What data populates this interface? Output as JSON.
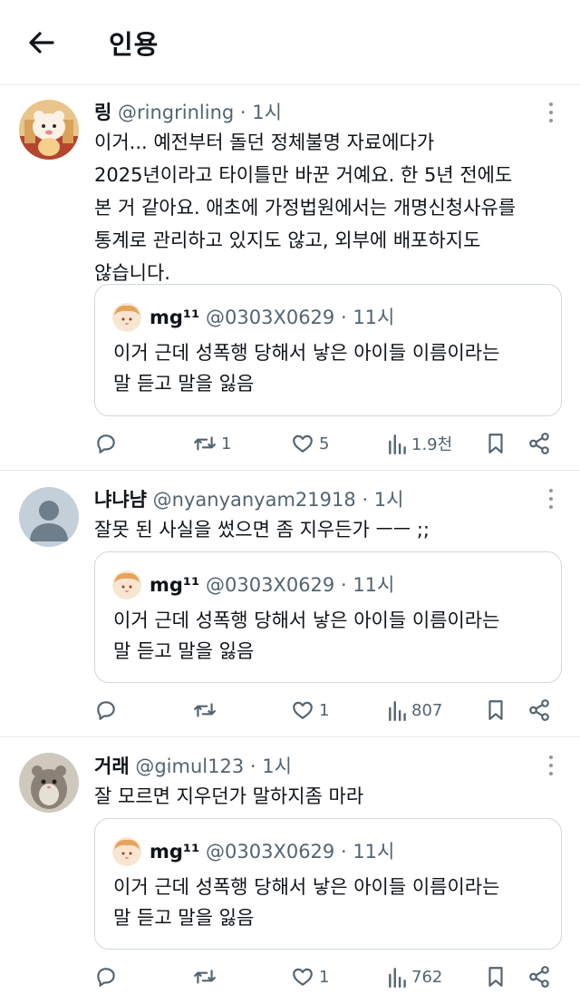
{
  "header": {
    "title": "인용"
  },
  "posts": [
    {
      "name": "링",
      "handle": "@ringrinling",
      "time": "· 1시",
      "text": "이거... 예전부터 돌던 정체불명 자료에다가\n2025년이라고 타이틀만 바꾼 거예요. 한 5년 전에도\n본 거 같아요. 애초에 가정법원에서는 개명신청사유를\n통계로 관리하고 있지도 않고, 외부에 배포하지도\n않습니다.",
      "quote": {
        "name": "mg¹¹",
        "handle": "@0303X0629",
        "time": "· 11시",
        "text": "이거 근데 성폭행 당해서 낳은 아이들 이름이라는\n말 듣고 말을 잃음"
      },
      "stats": {
        "replies": "",
        "reposts": "1",
        "likes": "5",
        "views": "1.9천"
      }
    },
    {
      "name": "냐냐냠",
      "handle": "@nyanyanyam21918",
      "time": "· 1시",
      "text": "잘못 된 사실을 썼으면 좀 지우든가 ㅡㅡ ;;",
      "quote": {
        "name": "mg¹¹",
        "handle": "@0303X0629",
        "time": "· 11시",
        "text": "이거 근데 성폭행 당해서 낳은 아이들 이름이라는\n말 듣고 말을 잃음"
      },
      "stats": {
        "replies": "",
        "reposts": "",
        "likes": "1",
        "views": "807"
      }
    },
    {
      "name": "거래",
      "handle": "@gimul123",
      "time": "· 1시",
      "text": "잘 모르면 지우던가 말하지좀 마라",
      "quote": {
        "name": "mg¹¹",
        "handle": "@0303X0629",
        "time": "· 11시",
        "text": "이거 근데 성폭행 당해서 낳은 아이들 이름이라는\n말 듣고 말을 잃음"
      },
      "stats": {
        "replies": "",
        "reposts": "",
        "likes": "1",
        "views": "762"
      }
    }
  ],
  "icons": {
    "back": "arrow-left-icon",
    "more": "more-vertical-icon",
    "reply": "reply-icon",
    "repost": "repost-icon",
    "like": "heart-icon",
    "views": "views-icon",
    "bookmark": "bookmark-icon",
    "share": "share-icon"
  },
  "colors": {
    "text": "#0f1419",
    "secondary": "#536471",
    "divider": "#e6e9ec",
    "quote_border": "#cfd9de"
  }
}
